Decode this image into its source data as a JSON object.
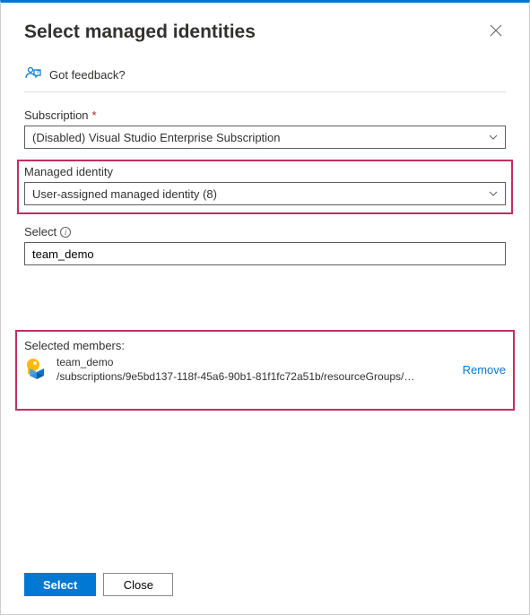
{
  "header": {
    "title": "Select managed identities"
  },
  "feedback": {
    "text": "Got feedback?"
  },
  "fields": {
    "subscription": {
      "label": "Subscription",
      "required_mark": "*",
      "value": "(Disabled) Visual Studio Enterprise Subscription"
    },
    "managed_identity": {
      "label": "Managed identity",
      "value": "User-assigned managed identity (8)"
    },
    "select": {
      "label": "Select",
      "value": "team_demo"
    }
  },
  "selected": {
    "label": "Selected members:",
    "member": {
      "name": "team_demo",
      "path": "/subscriptions/9e5bd137-118f-45a6-90b1-81f1fc72a51b/resourceGroups/…"
    },
    "remove_label": "Remove"
  },
  "footer": {
    "select_label": "Select",
    "close_label": "Close"
  }
}
